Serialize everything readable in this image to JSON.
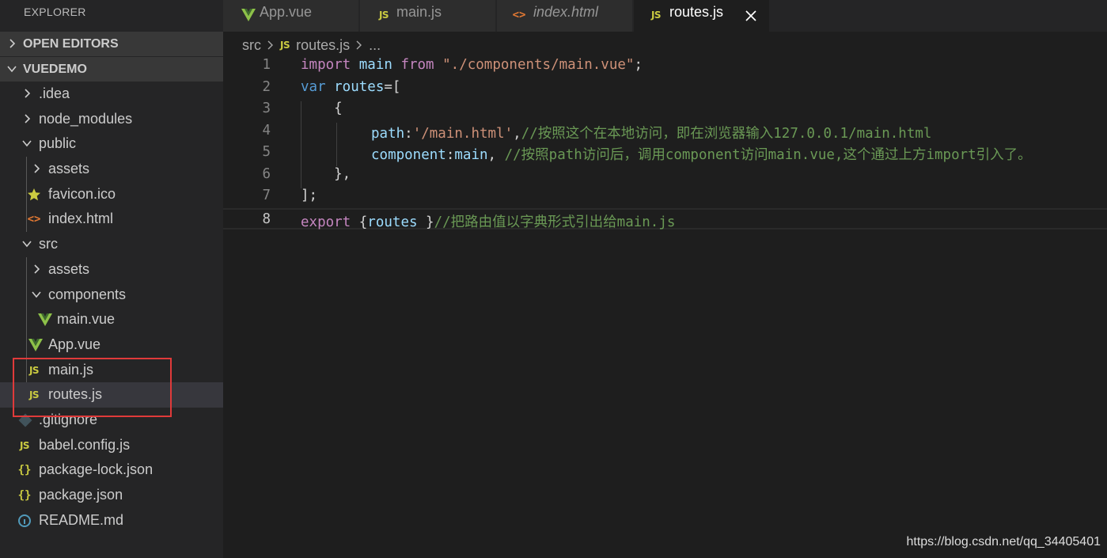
{
  "sidebar": {
    "title": "EXPLORER",
    "open_editors": "OPEN EDITORS",
    "project": "VUEDEMO",
    "items": [
      {
        "label": ".idea",
        "icon": "chevron-right-icon"
      },
      {
        "label": "node_modules",
        "icon": "chevron-right-icon"
      },
      {
        "label": "public",
        "icon": "chevron-down-icon"
      },
      {
        "label": "assets",
        "icon": "chevron-right-icon"
      },
      {
        "label": "favicon.ico",
        "icon": "star-icon"
      },
      {
        "label": "index.html",
        "icon": "html-icon",
        "glyph": "<>"
      },
      {
        "label": "src",
        "icon": "chevron-down-icon"
      },
      {
        "label": "assets",
        "icon": "chevron-right-icon"
      },
      {
        "label": "components",
        "icon": "chevron-down-icon"
      },
      {
        "label": "main.vue",
        "icon": "vue-icon"
      },
      {
        "label": "App.vue",
        "icon": "vue-icon"
      },
      {
        "label": "main.js",
        "icon": "js-icon",
        "glyph": "JS"
      },
      {
        "label": "routes.js",
        "icon": "js-icon",
        "glyph": "JS"
      },
      {
        "label": ".gitignore",
        "icon": "git-icon"
      },
      {
        "label": "babel.config.js",
        "icon": "js-icon",
        "glyph": "JS"
      },
      {
        "label": "package-lock.json",
        "icon": "json-icon",
        "glyph": "{}"
      },
      {
        "label": "package.json",
        "icon": "json-icon",
        "glyph": "{}"
      },
      {
        "label": "README.md",
        "icon": "info-icon"
      }
    ]
  },
  "tabs": [
    {
      "label": "App.vue",
      "icon": "vue-icon"
    },
    {
      "label": "main.js",
      "icon": "js-icon",
      "glyph": "JS"
    },
    {
      "label": "index.html",
      "icon": "html-icon",
      "glyph": "<>"
    },
    {
      "label": "routes.js",
      "icon": "js-icon",
      "glyph": "JS",
      "active": true
    }
  ],
  "breadcrumb": {
    "folder": "src",
    "file_glyph": "JS",
    "file": "routes.js",
    "more": "..."
  },
  "editor": {
    "line_numbers": [
      "1",
      "2",
      "3",
      "4",
      "5",
      "6",
      "7",
      "8"
    ],
    "l1": {
      "kw": "import",
      "id": " main ",
      "kw2": "from",
      "str": " \"./components/main.vue\"",
      "end": ";"
    },
    "l2": {
      "kw": "var",
      "id": " routes",
      "end": "=["
    },
    "l3": {
      "text": "    {"
    },
    "l4": {
      "key": "path",
      "colon": ":",
      "str": "'/main.html'",
      "comma": ",",
      "cmt": "//按照这个在本地访问，即在浏览器输入127.0.0.1/main.html"
    },
    "l5": {
      "key": "component",
      "colon": ":",
      "id": "main",
      "comma": ", ",
      "cmt": "//按照path访问后，调用component访问main.vue,这个通过上方import引入了。"
    },
    "l6": {
      "text": "    },"
    },
    "l7": {
      "text": "];"
    },
    "l8": {
      "kw": "export",
      "open": " {",
      "id": "routes",
      "close": " }",
      "cmt": "//把路由值以字典形式引出给main.js"
    }
  },
  "colors": {
    "keyword": "#c586c0",
    "storage": "#569cd6",
    "variable": "#9cdcfe",
    "string": "#ce9178",
    "comment": "#6a9955",
    "highlight_box": "#e03a3a",
    "js_icon": "#cbcb41",
    "vue_icon": "#8dc149"
  },
  "watermark": "https://blog.csdn.net/qq_34405401"
}
